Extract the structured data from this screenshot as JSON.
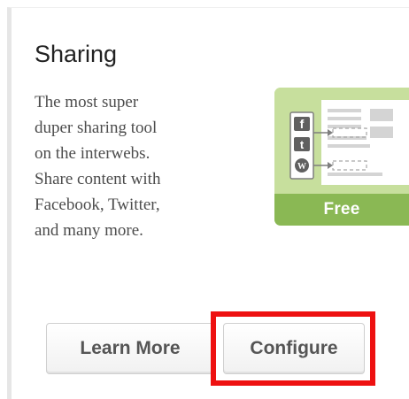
{
  "card": {
    "title": "Sharing",
    "description_lines": [
      "The most super",
      "duper sharing tool",
      "on the interwebs.",
      "Share content with",
      "Facebook, Twitter,",
      "and many more."
    ],
    "thumbnail": {
      "badge_label": "Free",
      "service_icons": [
        "facebook-icon",
        "twitter-icon",
        "wordpress-icon"
      ],
      "service_glyphs": [
        "f",
        "t",
        "W"
      ]
    },
    "buttons": {
      "learn_more_label": "Learn More",
      "configure_label": "Configure"
    }
  },
  "colors": {
    "thumbnail_background": "#c7df9d",
    "badge_band": "#8ab854",
    "highlight_border": "#ee1111",
    "title_text": "#222222",
    "description_text": "#4c4c4c",
    "button_text": "#555555"
  }
}
